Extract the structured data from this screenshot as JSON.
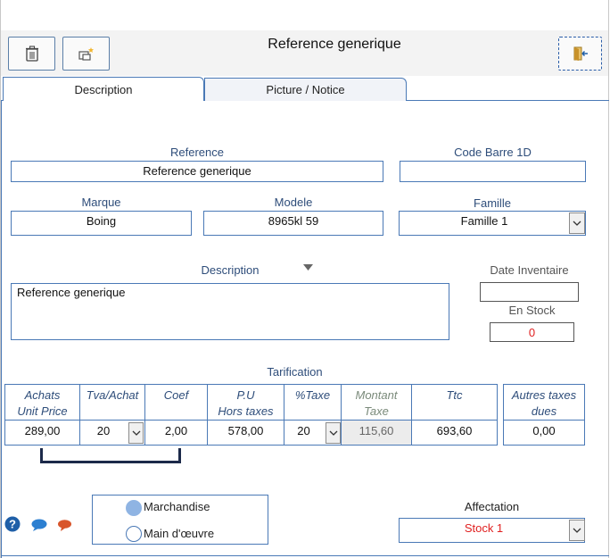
{
  "window": {
    "title": "Reference generique"
  },
  "toolbar": {
    "delete_icon": "trash-icon",
    "new_icon": "new-record-icon",
    "exit_icon": "exit-door-icon"
  },
  "tabs": [
    {
      "label": "Description",
      "active": true
    },
    {
      "label": "Picture / Notice",
      "active": false
    }
  ],
  "form": {
    "reference": {
      "label": "Reference",
      "value": "Reference generique"
    },
    "code_barre": {
      "label": "Code Barre 1D",
      "value": ""
    },
    "marque": {
      "label": "Marque",
      "value": "Boing"
    },
    "modele": {
      "label": "Modele",
      "value": "8965kl 59"
    },
    "famille": {
      "label": "Famille",
      "value": "Famille 1"
    },
    "description": {
      "label": "Description",
      "value": "Reference generique"
    },
    "date_inventaire": {
      "label": "Date Inventaire",
      "value": ""
    },
    "en_stock": {
      "label": "En Stock",
      "value": "0"
    }
  },
  "tarification": {
    "title": "Tarification",
    "headers": {
      "achats_1": "Achats",
      "achats_2": "Unit Price",
      "tva_achat": "Tva/Achat",
      "coef": "Coef",
      "pu_1": "P.U",
      "pu_2": "Hors taxes",
      "taxe": "%Taxe",
      "montant_1": "Montant",
      "montant_2": "Taxe",
      "ttc": "Ttc",
      "autres_1": "Autres taxes",
      "autres_2": "dues"
    },
    "values": {
      "achats": "289,00",
      "tva_achat": "20",
      "coef": "2,00",
      "pu": "578,00",
      "taxe": "20",
      "montant": "115,60",
      "ttc": "693,60",
      "autres": "0,00"
    }
  },
  "type": {
    "options": [
      "Marchandise",
      "Main d'œuvre"
    ],
    "selected": "Marchandise"
  },
  "affectation": {
    "label": "Affectation",
    "value": "Stock 1"
  },
  "colors": {
    "accent": "#4a79b6",
    "label": "#2e4d7a",
    "red_value": "#e02020",
    "help_blue": "#1f5fa8",
    "bubble_orange": "#d8552b"
  }
}
